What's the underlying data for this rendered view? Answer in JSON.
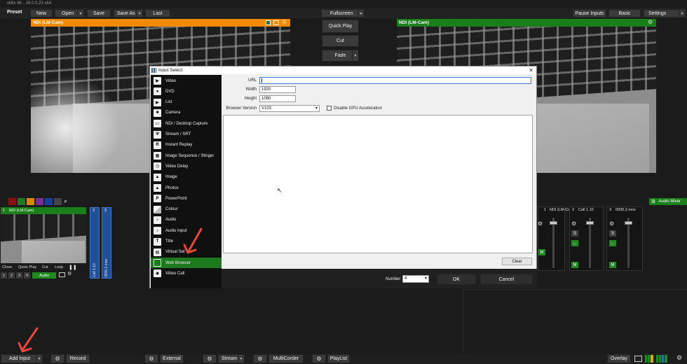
{
  "app": {
    "title": "vMix 4K - 26.0.0.23 x64"
  },
  "toolbar": {
    "preset": "Preset",
    "new": "New",
    "open": "Open",
    "save": "Save",
    "save_as": "Save As",
    "last": "Last",
    "fullscreen": "Fullscreen",
    "pause_inputs": "Pause Inputs",
    "basic": "Basic",
    "settings": "Settings"
  },
  "preview": {
    "label": "NDI (LM-Cam)",
    "header_color": "#f28a00"
  },
  "output": {
    "label": "NDI (LM-Cam)",
    "header_color": "#1a7f1a"
  },
  "transitions": {
    "quick_play": "Quick Play",
    "cut": "Cut",
    "fade": "Fade"
  },
  "colour_swatches": [
    "#8a1010",
    "#1e7a1e",
    "#d28a10",
    "#7a2c9a",
    "#1c3f9a"
  ],
  "inputs": {
    "input1": {
      "number": "1",
      "label": "NDI (LM-Cam)",
      "buttons": [
        "Close",
        "Quick Play",
        "Cut",
        "Loop"
      ],
      "numbers": [
        "1",
        "2",
        "3",
        "4"
      ],
      "audio": "Audio"
    },
    "input2": {
      "number": "2",
      "label": "Call 1.10"
    },
    "input3": {
      "number": "3",
      "label": "0930.2.mov"
    }
  },
  "audio_mixer": {
    "label": "Audio Mixer",
    "channels": [
      {
        "number": "1",
        "label": "NDI (LM-Cam)"
      },
      {
        "number": "2",
        "label": "Call 1.10"
      },
      {
        "number": "3",
        "label": "0930.2.mov"
      }
    ],
    "s_label": "S",
    "m_label": "M"
  },
  "dialog": {
    "title": "Input Select",
    "types": [
      {
        "label": "Video",
        "icon": "play-icon",
        "glyph": "▶"
      },
      {
        "label": "DVD",
        "icon": "disc-icon",
        "glyph": "●"
      },
      {
        "label": "List",
        "icon": "list-icon",
        "glyph": "▶"
      },
      {
        "label": "Camera",
        "icon": "camera-icon",
        "glyph": "■"
      },
      {
        "label": "NDI / Desktop Capture",
        "icon": "monitor-icon",
        "glyph": "▭"
      },
      {
        "label": "Stream / SRT",
        "icon": "antenna-icon",
        "glyph": "Ψ"
      },
      {
        "label": "Instant Replay",
        "icon": "replay-icon",
        "glyph": "R"
      },
      {
        "label": "Image Sequence / Stinger",
        "icon": "film-icon",
        "glyph": "▦"
      },
      {
        "label": "Video Delay",
        "icon": "clock-icon",
        "glyph": "◷"
      },
      {
        "label": "Image",
        "icon": "image-icon",
        "glyph": "▲"
      },
      {
        "label": "Photos",
        "icon": "photos-icon",
        "glyph": "▲"
      },
      {
        "label": "PowerPoint",
        "icon": "powerpoint-icon",
        "glyph": "P"
      },
      {
        "label": "Colour",
        "icon": "colour-icon",
        "glyph": ""
      },
      {
        "label": "Audio",
        "icon": "speaker-icon",
        "glyph": "♪"
      },
      {
        "label": "Audio Input",
        "icon": "microphone-icon",
        "glyph": "♪"
      },
      {
        "label": "Title",
        "icon": "title-icon",
        "glyph": "T"
      },
      {
        "label": "Virtual Set",
        "icon": "virtual-set-icon",
        "glyph": "▤"
      },
      {
        "label": "Web Browser",
        "icon": "web-browser-icon",
        "glyph": ""
      },
      {
        "label": "Video Call",
        "icon": "video-call-icon",
        "glyph": "◉"
      }
    ],
    "selected_index": 17,
    "url_label": "URL",
    "url_value": "",
    "width_label": "Width",
    "width_value": "1920",
    "height_label": "Height",
    "height_value": "1080",
    "browser_version_label": "Browser Version",
    "browser_version_value": "V103",
    "gpu_label": "Disable GPU Acceleration",
    "clear": "Clear",
    "number_label": "Number",
    "number_value": "4",
    "ok": "OK",
    "cancel": "Cancel"
  },
  "bottombar": {
    "add_input": "Add Input",
    "record": "Record",
    "external": "External",
    "stream": "Stream",
    "multicorder": "MultiCorder",
    "playlist": "PlayList",
    "overlay": "Overlay"
  },
  "annotation_color": "#e8473a"
}
